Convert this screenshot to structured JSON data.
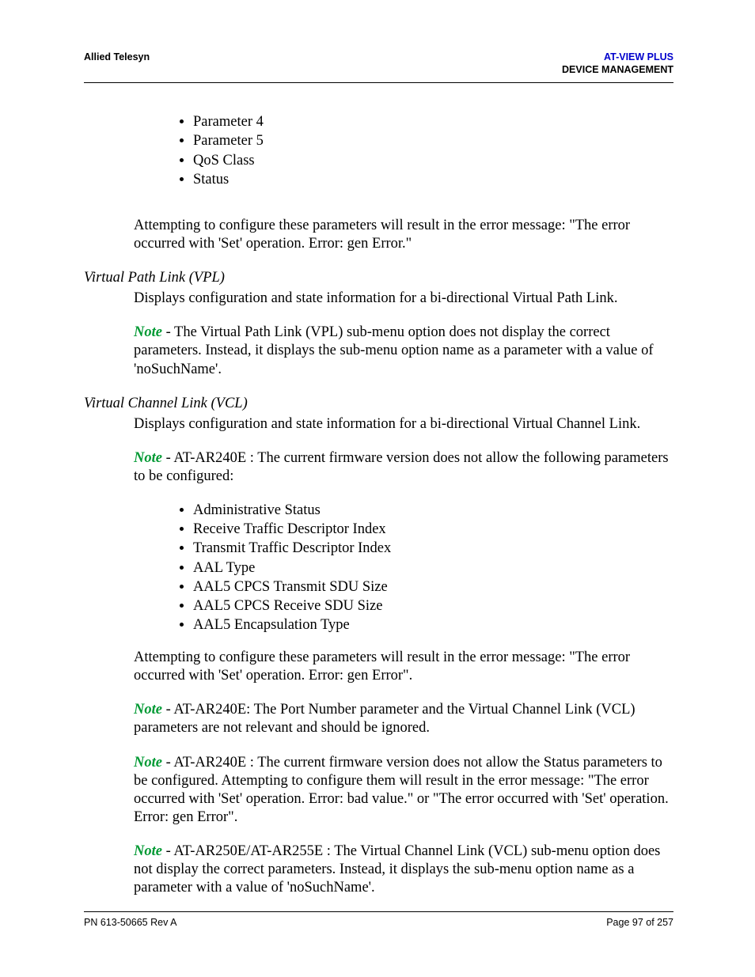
{
  "header": {
    "company": "Allied Telesyn",
    "product": "AT-VIEW PLUS",
    "section": "DEVICE MANAGEMENT"
  },
  "topList": [
    "Parameter 4",
    "Parameter 5",
    "QoS Class",
    "Status"
  ],
  "topPara": "Attempting to configure these parameters will result in the error message: \"The error occurred with 'Set' operation. Error: gen Error.\"",
  "vpl": {
    "heading": "Virtual Path Link (VPL)",
    "desc": "Displays configuration and state information for a bi-directional Virtual Path Link.",
    "noteLabel": "Note",
    "noteText": " - The Virtual Path Link (VPL) sub-menu option does not display the correct parameters. Instead, it displays the sub-menu option name as a parameter with a value of 'noSuchName'."
  },
  "vcl": {
    "heading": "Virtual Channel Link (VCL)",
    "desc": "Displays configuration and state information for a bi-directional Virtual Channel Link.",
    "note1Label": "Note",
    "note1Text": " - AT-AR240E : The current firmware version does not allow the following parameters to be configured:",
    "list": [
      "Administrative Status",
      "Receive Traffic Descriptor Index",
      "Transmit Traffic Descriptor Index",
      "AAL Type",
      "AAL5 CPCS Transmit SDU Size",
      "AAL5 CPCS Receive SDU Size",
      "AAL5 Encapsulation Type"
    ],
    "afterListPara": "Attempting to configure these parameters will result in the error message: \"The error occurred with 'Set' operation. Error: gen Error\".",
    "note2Label": "Note",
    "note2Text": " - AT-AR240E: The Port Number parameter and the Virtual Channel Link (VCL) parameters are not relevant and should be ignored.",
    "note3Label": "Note",
    "note3Text": " - AT-AR240E : The current firmware version does not allow the Status parameters to be configured. Attempting to configure them will result in the error message: \"The error occurred with 'Set' operation. Error: bad value.\" or \"The error occurred with 'Set' operation. Error: gen Error\".",
    "note4Label": "Note",
    "note4Text": " - AT-AR250E/AT-AR255E : The Virtual Channel Link (VCL) sub-menu option does not display the correct parameters. Instead, it displays the sub-menu option name as a parameter with a value of 'noSuchName'."
  },
  "footer": {
    "pn": "PN 613-50665 Rev A",
    "page": "Page 97 of 257"
  }
}
